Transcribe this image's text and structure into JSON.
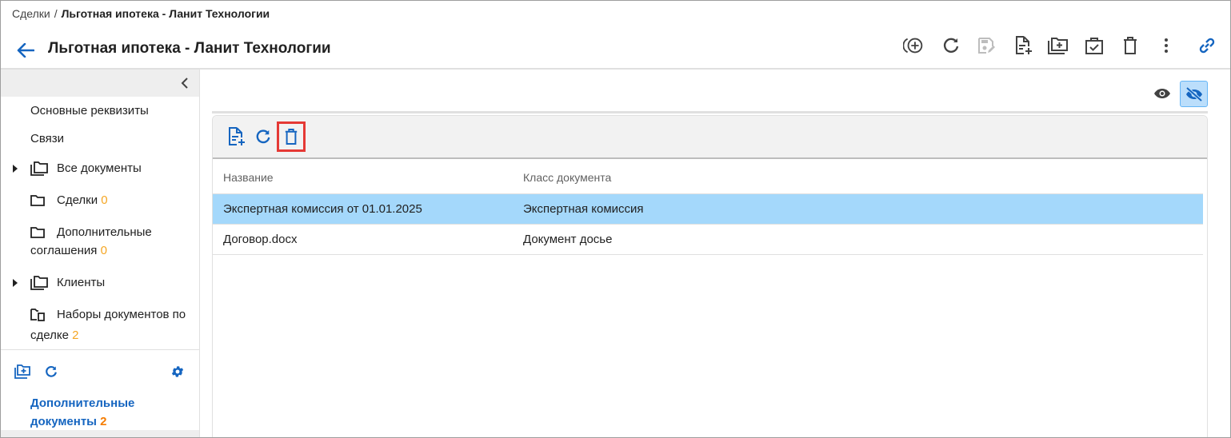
{
  "breadcrumb": {
    "parent": "Сделки",
    "separator": "/",
    "current": "Льготная ипотека - Ланит Технологии"
  },
  "header": {
    "title": "Льготная ипотека - Ланит Технологии",
    "back_icon": "arrow-left-icon",
    "toolbar_icons": [
      "add-circle-icon",
      "refresh-icon",
      "save-disabled-icon",
      "add-document-icon",
      "add-folder-icon",
      "task-check-icon",
      "delete-icon",
      "more-vert-icon",
      "link-icon"
    ]
  },
  "sidebar": {
    "items": [
      {
        "label": "Основные реквизиты"
      },
      {
        "label": "Связи"
      },
      {
        "label": "Все документы",
        "icon": "folder-multiple-icon",
        "expandable": true
      },
      {
        "label": "Сделки",
        "count": "0",
        "icon": "folder-icon"
      },
      {
        "label": "Дополнительные",
        "label2": "соглашения",
        "count": "0",
        "icon": "folder-icon"
      },
      {
        "label": "Клиенты",
        "icon": "folder-multiple-icon",
        "expandable": true
      },
      {
        "label": "Наборы документов по",
        "label2": "сделке",
        "count": "2",
        "icon": "document-set-icon"
      }
    ],
    "bottom_icons": [
      "add-folder-icon",
      "refresh-icon",
      "gear-icon"
    ],
    "active": {
      "label": "Дополнительные",
      "label2": "документы",
      "count": "2"
    }
  },
  "main": {
    "view_icons": [
      "eye-icon",
      "eye-off-icon"
    ],
    "panel_toolbar_icons": [
      "add-document-icon",
      "refresh-icon",
      "delete-icon"
    ],
    "table": {
      "columns": [
        "Название",
        "Класс документа"
      ],
      "rows": [
        {
          "name": "Экспертная комиссия от 01.01.2025",
          "class": "Экспертная комиссия",
          "selected": true
        },
        {
          "name": "Договор.docx",
          "class": "Документ досье",
          "selected": false
        }
      ]
    }
  },
  "colors": {
    "accent": "#1565c0",
    "selected_row": "#a4d8fb",
    "count": "#f5a623",
    "highlight_border": "#e53935"
  }
}
